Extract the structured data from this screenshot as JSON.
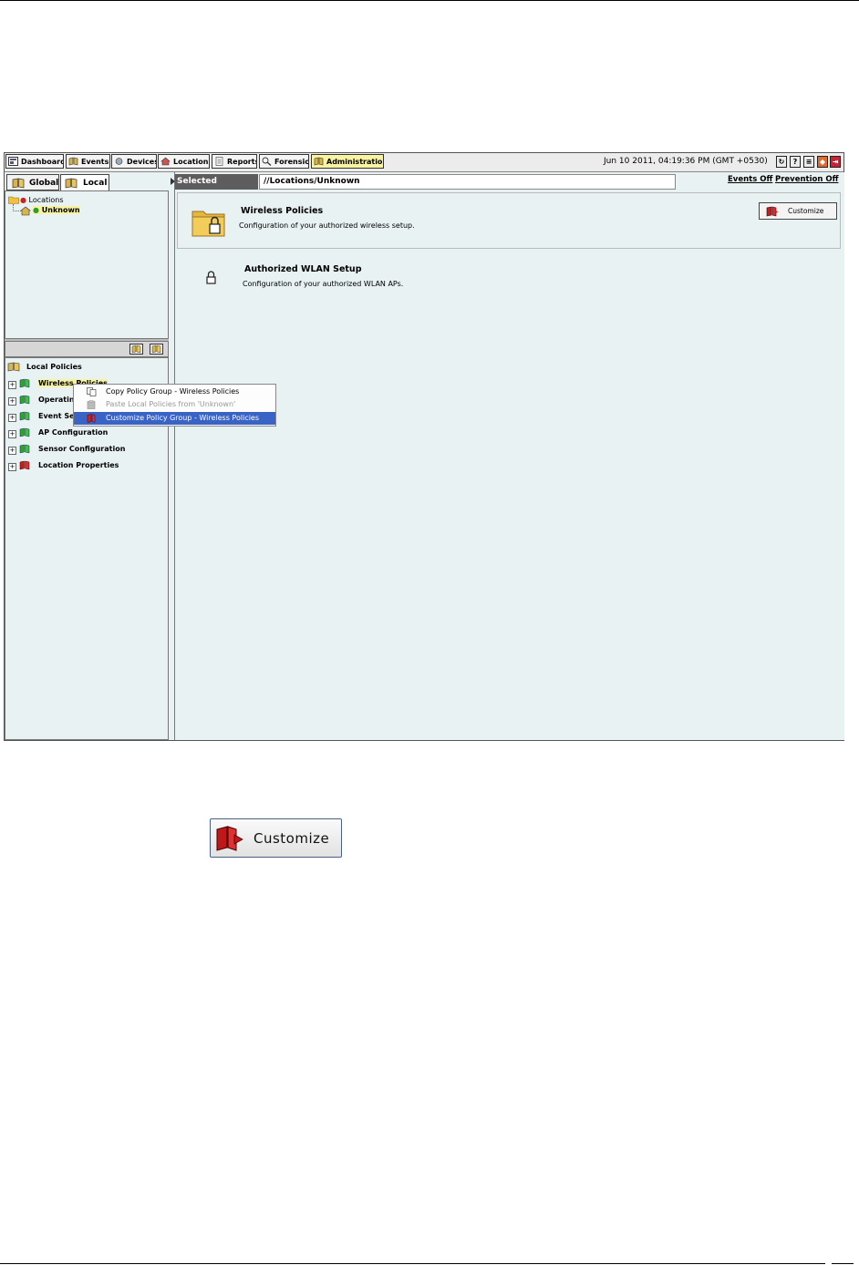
{
  "nav": {
    "tabs": [
      {
        "label": "Dashboard"
      },
      {
        "label": "Events"
      },
      {
        "label": "Devices"
      },
      {
        "label": "Locations"
      },
      {
        "label": "Reports"
      },
      {
        "label": "Forensics"
      },
      {
        "label": "Administration"
      }
    ],
    "active_tab": "Administration",
    "datetime": "Jun 10 2011, 04:19:36 PM (GMT +0530)",
    "tool_icons": [
      "refresh-icon",
      "help-icon",
      "list-icon",
      "shield-icon",
      "logout-icon"
    ]
  },
  "left": {
    "tabs": [
      {
        "label": "Global"
      },
      {
        "label": "Local"
      }
    ],
    "active_tab": "Local",
    "location_tree": {
      "root": "Locations",
      "child": "Unknown"
    },
    "policies": {
      "root": "Local Policies",
      "items": [
        {
          "label": "Wireless Policies"
        },
        {
          "label": "Operating Policies"
        },
        {
          "label": "Event Settings"
        },
        {
          "label": "AP Configuration"
        },
        {
          "label": "Sensor Configuration"
        },
        {
          "label": "Location Properties"
        }
      ]
    }
  },
  "context_menu": {
    "items": [
      {
        "label": "Copy Policy Group - Wireless Policies",
        "state": "normal"
      },
      {
        "label": "Paste Local Policies from 'Unknown'",
        "state": "disabled"
      },
      {
        "label": "Customize Policy Group - Wireless Policies",
        "state": "selected"
      }
    ]
  },
  "main": {
    "selected_location_label": "Selected Location:",
    "selected_location_path": "//Locations/Unknown",
    "events_link": "Events Off",
    "prevention_link": "Prevention Off",
    "sections": [
      {
        "title": "Wireless Policies",
        "desc": "Configuration of your authorized wireless setup.",
        "button": "Customize"
      },
      {
        "title": "Authorized WLAN Setup",
        "desc": "Configuration of your authorized WLAN APs."
      }
    ]
  },
  "callout": {
    "button_label": "Customize"
  },
  "colors": {
    "accent_selected": "#3a63c6",
    "active_tab": "#f7f3a0",
    "panel_bg": "#e8f2f2"
  }
}
